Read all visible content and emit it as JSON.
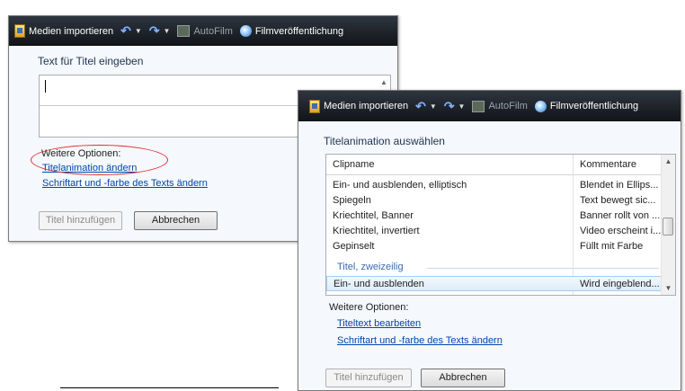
{
  "toolbar": {
    "import_label": "Medien importieren",
    "autofilm_label": "AutoFilm",
    "publish_label": "Filmveröffentlichung"
  },
  "window1": {
    "heading": "Text für Titel eingeben",
    "text_value": "",
    "more_options_label": "Weitere Optionen:",
    "links": [
      "Titelanimation ändern",
      "Schriftart und -farbe des Texts ändern"
    ],
    "add_title_button": "Titel hinzufügen",
    "cancel_button": "Abbrechen"
  },
  "window2": {
    "heading": "Titelanimation auswählen",
    "columns": [
      "Clipname",
      "Kommentare"
    ],
    "rows": [
      {
        "name": "Ein- und ausblenden, elliptisch",
        "comment": "Blendet in Ellips..."
      },
      {
        "name": "Spiegeln",
        "comment": "Text bewegt sic..."
      },
      {
        "name": "Kriechtitel, Banner",
        "comment": "Banner rollt von ..."
      },
      {
        "name": "Kriechtitel, invertiert",
        "comment": "Video erscheint i..."
      },
      {
        "name": "Gepinselt",
        "comment": "Füllt mit Farbe"
      }
    ],
    "group_label": "Titel, zweizeilig",
    "selected_row": {
      "name": "Ein- und ausblenden",
      "comment": "Wird eingeblend..."
    },
    "more_options_label": "Weitere Optionen:",
    "links": [
      "Titeltext bearbeiten",
      "Schriftart und -farbe des Texts ändern"
    ],
    "add_title_button": "Titel hinzufügen",
    "cancel_button": "Abbrechen"
  },
  "colors": {
    "link": "#0047ab",
    "annotation_oval": "#e03030",
    "toolbar_bg": "#1a1e24"
  }
}
